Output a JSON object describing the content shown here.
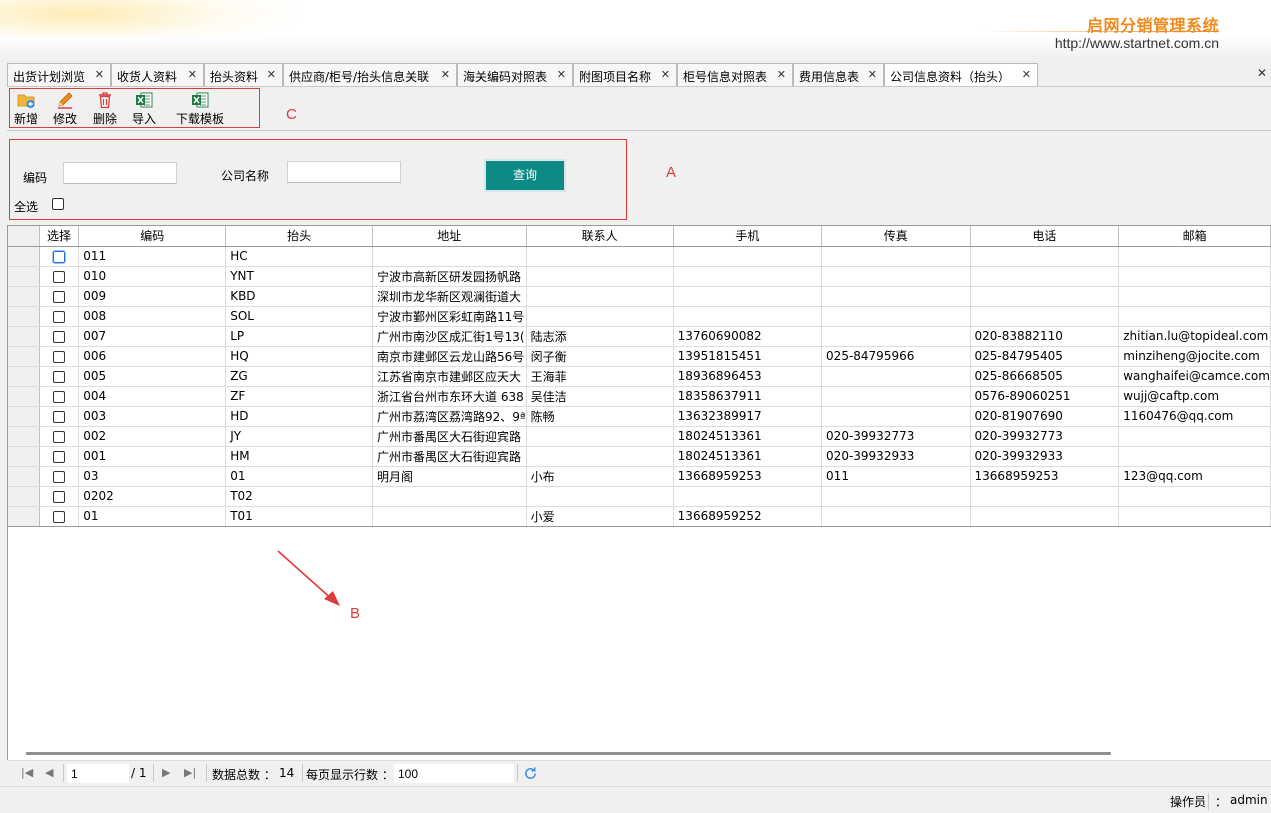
{
  "header": {
    "brand": "启网分销管理系统",
    "url": "http://www.startnet.com.cn"
  },
  "tabs": [
    {
      "label": "出货计划浏览"
    },
    {
      "label": "收货人资料"
    },
    {
      "label": "抬头资料"
    },
    {
      "label": "供应商/柜号/抬头信息关联"
    },
    {
      "label": "海关编码对照表"
    },
    {
      "label": "附图项目名称"
    },
    {
      "label": "柜号信息对照表"
    },
    {
      "label": "费用信息表"
    },
    {
      "label": "公司信息资料（抬头）",
      "active": true
    }
  ],
  "toolbar": {
    "add": "新增",
    "edit": "修改",
    "delete": "删除",
    "import": "导入",
    "download_template": "下载模板"
  },
  "annotations": {
    "a": "A",
    "b": "B",
    "c": "C"
  },
  "search": {
    "code_label": "编码",
    "code_value": "",
    "company_label": "公司名称",
    "company_value": "",
    "query_button": "查询",
    "select_all_label": "全选"
  },
  "grid": {
    "columns": [
      "选择",
      "编码",
      "抬头",
      "地址",
      "联系人",
      "手机",
      "传真",
      "电话",
      "邮箱"
    ],
    "rows": [
      {
        "code": "011",
        "title": "HC",
        "address": "",
        "contact": "",
        "mobile": "",
        "fax": "",
        "phone": "",
        "email": ""
      },
      {
        "code": "010",
        "title": "YNT",
        "address": "宁波市高新区研发园扬帆路",
        "contact": "",
        "mobile": "",
        "fax": "",
        "phone": "",
        "email": ""
      },
      {
        "code": "009",
        "title": "KBD",
        "address": "深圳市龙华新区观澜街道大",
        "contact": "",
        "mobile": "",
        "fax": "",
        "phone": "",
        "email": ""
      },
      {
        "code": "008",
        "title": "SOL",
        "address": "宁波市鄞州区彩虹南路11号",
        "contact": "",
        "mobile": "",
        "fax": "",
        "phone": "",
        "email": ""
      },
      {
        "code": "007",
        "title": "LP",
        "address": "广州市南沙区成汇街1号13(",
        "contact": "陆志添",
        "mobile": "13760690082",
        "fax": "",
        "phone": "020-83882110",
        "email": "zhitian.lu@topideal.com"
      },
      {
        "code": "006",
        "title": "HQ",
        "address": "南京市建邺区云龙山路56号",
        "contact": "闵子衡",
        "mobile": "13951815451",
        "fax": "025-84795966",
        "phone": "025-84795405",
        "email": "minziheng@jocite.com"
      },
      {
        "code": "005",
        "title": "ZG",
        "address": "江苏省南京市建邺区应天大",
        "contact": "王海菲",
        "mobile": "18936896453",
        "fax": "",
        "phone": "025-86668505",
        "email": "wanghaifei@camce.com"
      },
      {
        "code": "004",
        "title": "ZF",
        "address": "浙江省台州市东环大道 638",
        "contact": "吴佳洁",
        "mobile": "18358637911",
        "fax": "",
        "phone": "0576-89060251",
        "email": "wujj@caftp.com"
      },
      {
        "code": "003",
        "title": "HD",
        "address": "广州市荔湾区荔湾路92、9ª",
        "contact": "陈畅",
        "mobile": "13632389917",
        "fax": "",
        "phone": "020-81907690",
        "email": "1160476@qq.com"
      },
      {
        "code": "002",
        "title": "JY",
        "address": "广州市番禺区大石街迎宾路",
        "contact": "",
        "mobile": "18024513361",
        "fax": "020-39932773",
        "phone": "020-39932773",
        "email": ""
      },
      {
        "code": "001",
        "title": "HM",
        "address": "广州市番禺区大石街迎宾路",
        "contact": "",
        "mobile": "18024513361",
        "fax": "020-39932933",
        "phone": "020-39932933",
        "email": ""
      },
      {
        "code": "03",
        "title": "01",
        "address": "明月阁",
        "contact": "小布",
        "mobile": "13668959253",
        "fax": "011",
        "phone": "13668959253",
        "email": "123@qq.com"
      },
      {
        "code": "0202",
        "title": "T02",
        "address": "",
        "contact": "",
        "mobile": "",
        "fax": "",
        "phone": "",
        "email": ""
      },
      {
        "code": "01",
        "title": "T01",
        "address": "",
        "contact": "小爱",
        "mobile": "13668959252",
        "fax": "",
        "phone": "",
        "email": ""
      }
    ]
  },
  "pager": {
    "current_page": "1",
    "total_pages": "/ 1",
    "total_label": "数据总数 ：",
    "total_value": "14",
    "page_size_label": "每页显示行数 ：",
    "page_size_value": "100"
  },
  "status": {
    "operator_label": "操作员",
    "sep": "：",
    "operator_value": "admin"
  },
  "colors": {
    "brand": "#f08a1c",
    "query_button": "#0d8a85",
    "annotation": "#e0393c"
  }
}
